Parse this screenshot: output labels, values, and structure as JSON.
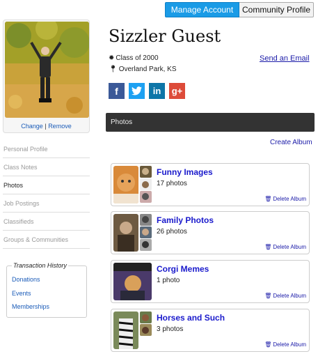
{
  "header": {
    "manage_account": "Manage Account",
    "community_profile": "Community Profile"
  },
  "avatar": {
    "change": "Change",
    "separator": "|",
    "remove": "Remove"
  },
  "sidebar": {
    "items": [
      {
        "label": "Personal Profile"
      },
      {
        "label": "Class Notes"
      },
      {
        "label": "Photos",
        "active": true
      },
      {
        "label": "Job Postings"
      },
      {
        "label": "Classifieds"
      },
      {
        "label": "Groups & Communities"
      }
    ],
    "transaction_history": {
      "title": "Transaction History",
      "links": [
        "Donations",
        "Events",
        "Memberships"
      ]
    }
  },
  "profile": {
    "name": "Sizzler Guest",
    "class_of": "Class of 2000",
    "location": "Overland Park, KS",
    "send_email": "Send an Email",
    "socials": [
      "facebook-icon",
      "twitter-icon",
      "linkedin-icon",
      "google-plus-icon"
    ]
  },
  "photos": {
    "section_title": "Photos",
    "create_album": "Create Album",
    "delete_label": "Delete Album",
    "albums": [
      {
        "title": "Funny Images",
        "count": "17 photos"
      },
      {
        "title": "Family Photos",
        "count": "26 photos"
      },
      {
        "title": "Corgi Memes",
        "count": "1 photo"
      },
      {
        "title": "Horses and Such",
        "count": "3 photos"
      }
    ]
  },
  "colors": {
    "accent": "#1a9be6",
    "section_bar": "#333333",
    "link": "#1a1aa8",
    "album_title": "#1a1acc"
  }
}
